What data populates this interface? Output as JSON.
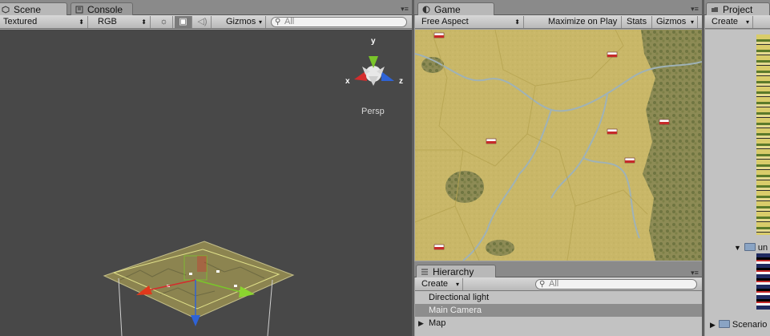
{
  "scene_panel": {
    "tabs": [
      {
        "label": "Scene",
        "icon": "scene-icon"
      },
      {
        "label": "Console",
        "icon": "console-icon"
      }
    ],
    "render_mode": "Textured",
    "color_mode": "RGB",
    "toggles": [
      {
        "icon": "sun-icon",
        "active": false
      },
      {
        "icon": "image-icon",
        "active": true
      },
      {
        "icon": "speaker-icon",
        "active": false
      }
    ],
    "gizmos_label": "Gizmos",
    "search_placeholder": "All",
    "view_label": "Persp",
    "axes": {
      "x": "x",
      "y": "y",
      "z": "z"
    }
  },
  "game_panel": {
    "tab": {
      "label": "Game",
      "icon": "game-icon"
    },
    "aspect": "Free Aspect",
    "maximize_label": "Maximize on Play",
    "stats_label": "Stats",
    "gizmos_label": "Gizmos"
  },
  "hierarchy_panel": {
    "tab": {
      "label": "Hierarchy",
      "icon": "hierarchy-icon"
    },
    "create_label": "Create",
    "search_placeholder": "All",
    "items": [
      {
        "label": "Directional light",
        "selected": false,
        "has_children": false
      },
      {
        "label": "Main Camera",
        "selected": true,
        "has_children": false
      },
      {
        "label": "Map",
        "selected": false,
        "has_children": true
      }
    ]
  },
  "project_panel": {
    "tab": {
      "label": "Project",
      "icon": "project-icon"
    },
    "create_label": "Create",
    "folders": [
      {
        "label": "un",
        "expanded": true
      },
      {
        "label": "Scenario",
        "expanded": false
      }
    ]
  },
  "colors": {
    "scene_bg": "#484848",
    "map_base": "#c9b768",
    "river": "#9fb2b7",
    "selection": "#8d8d8d",
    "axis_x": "#d42c2c",
    "axis_y": "#7ac52a",
    "axis_z": "#2e63d6"
  }
}
